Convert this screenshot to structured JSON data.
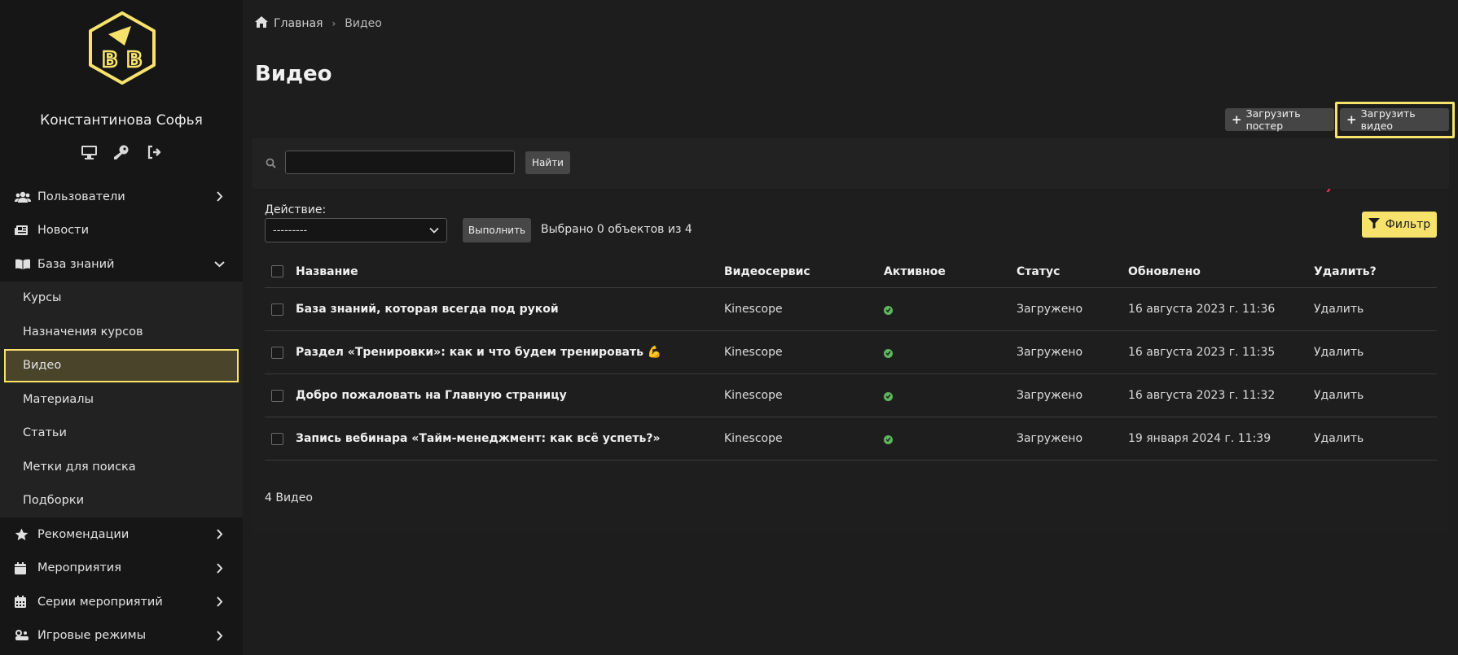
{
  "user": {
    "name": "Константинова Софья"
  },
  "logo": {
    "letters": [
      "В",
      "В"
    ]
  },
  "sidebar": {
    "items": [
      {
        "label": "Пользователи",
        "icon": "users-icon",
        "chevron": "right"
      },
      {
        "label": "Новости",
        "icon": "newspaper-icon",
        "chevron": ""
      },
      {
        "label": "База знаний",
        "icon": "book-icon",
        "chevron": "down"
      }
    ],
    "subitems": [
      {
        "label": "Курсы"
      },
      {
        "label": "Назначения курсов"
      },
      {
        "label": "Видео",
        "active": true
      },
      {
        "label": "Материалы"
      },
      {
        "label": "Статьи"
      },
      {
        "label": "Метки для поиска"
      },
      {
        "label": "Подборки"
      }
    ],
    "bottom_items": [
      {
        "label": "Рекомендации",
        "icon": "star-icon"
      },
      {
        "label": "Мероприятия",
        "icon": "calendar-icon"
      },
      {
        "label": "Серии мероприятий",
        "icon": "calendar-grid-icon"
      },
      {
        "label": "Игровые режимы",
        "icon": "game-icon"
      }
    ]
  },
  "breadcrumb": {
    "home": "Главная",
    "current": "Видео"
  },
  "page": {
    "title": "Видео"
  },
  "toolbar": {
    "upload_poster": "Загрузить постер",
    "upload_video": "Загрузить видео"
  },
  "search": {
    "value": "",
    "button": "Найти"
  },
  "actions": {
    "label": "Действие:",
    "selected": "---------",
    "run": "Выполнить",
    "selected_count": "Выбрано 0 объектов из 4",
    "filter": "Фильтр"
  },
  "table": {
    "headers": {
      "name": "Название",
      "service": "Видеосервис",
      "active": "Активное",
      "status": "Статус",
      "updated": "Обновлено",
      "delete": "Удалить?"
    },
    "rows": [
      {
        "name": "База знаний, которая всегда под рукой",
        "service": "Kinescope",
        "active": true,
        "status": "Загружено",
        "updated": "16 августа 2023 г. 11:36",
        "delete": "Удалить"
      },
      {
        "name": "Раздел «Тренировки»: как и что будем тренировать 💪",
        "service": "Kinescope",
        "active": true,
        "status": "Загружено",
        "updated": "16 августа 2023 г. 11:35",
        "delete": "Удалить"
      },
      {
        "name": "Добро пожаловать на Главную страницу",
        "service": "Kinescope",
        "active": true,
        "status": "Загружено",
        "updated": "16 августа 2023 г. 11:32",
        "delete": "Удалить"
      },
      {
        "name": "Запись вебинара «Тайм-менеджмент: как всё успеть?»",
        "service": "Kinescope",
        "active": true,
        "status": "Загружено",
        "updated": "19 января 2024 г. 11:39",
        "delete": "Удалить"
      }
    ],
    "footer": "4 Видео"
  },
  "colors": {
    "accent": "#f7e36c",
    "arrow": "#d6335a",
    "ok": "#5cb85c"
  }
}
